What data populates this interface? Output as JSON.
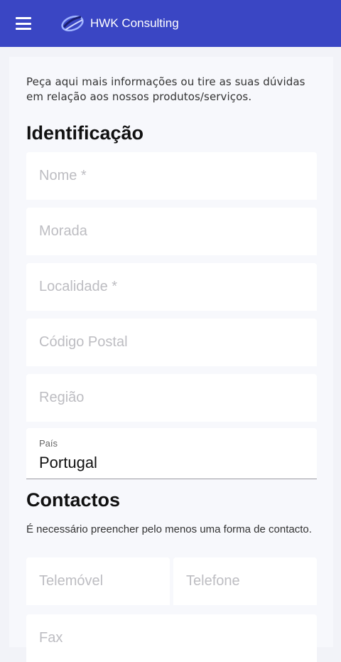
{
  "appbar": {
    "title": "HWK Consulting",
    "menu_icon": "hamburger-menu-icon",
    "logo_icon": "hwk-logo-icon",
    "color": "#3a46c4"
  },
  "form": {
    "intro": "Peça aqui mais informações ou tire as suas dúvidas em relação aos nossos produtos/serviços.",
    "identification_title": "Identificação",
    "fields": {
      "nome_placeholder": "Nome *",
      "morada_placeholder": "Morada",
      "localidade_placeholder": "Localidade *",
      "codigo_postal_placeholder": "Código Postal",
      "regiao_placeholder": "Região",
      "pais_label": "País",
      "pais_value": "Portugal"
    },
    "contacts_title": "Contactos",
    "contacts_note": "É necessário preencher pelo menos uma forma de contacto.",
    "contact_fields": {
      "telemovel_placeholder": "Telemóvel",
      "telefone_placeholder": "Telefone",
      "fax_placeholder": "Fax"
    }
  }
}
